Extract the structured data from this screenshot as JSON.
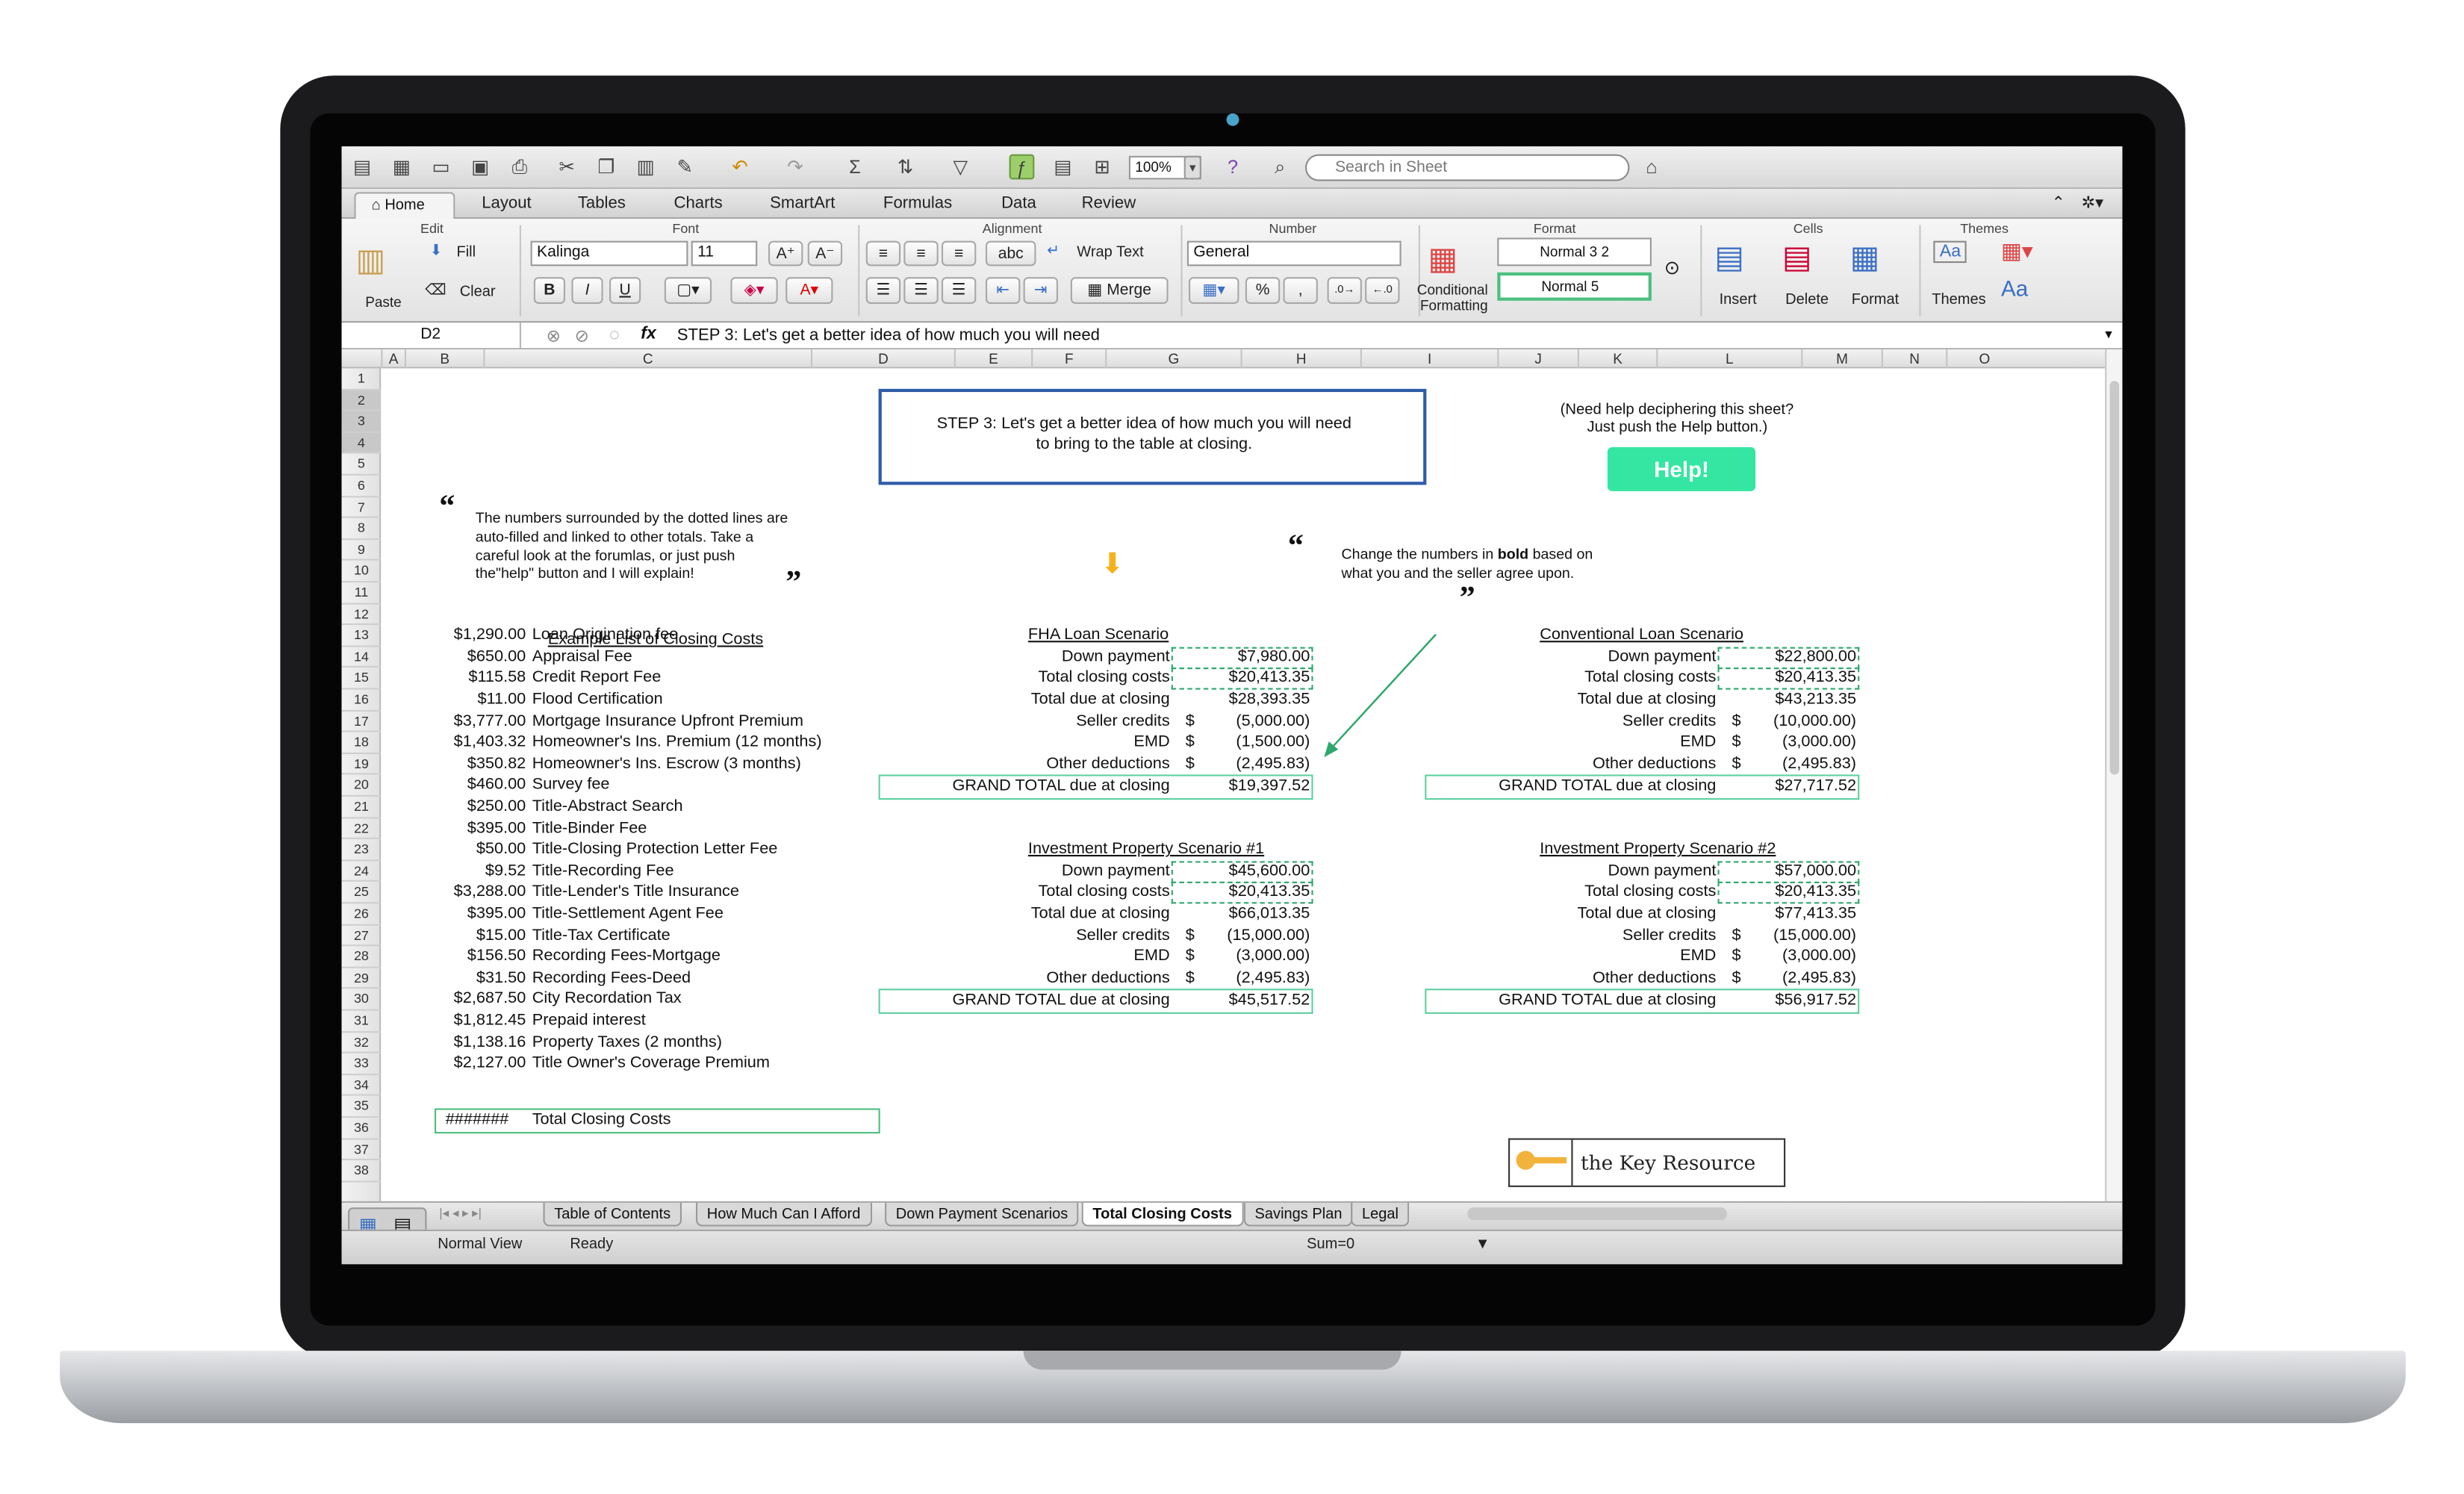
{
  "toolbar": {
    "zoom": "100%",
    "search_placeholder": "Search in Sheet"
  },
  "ribbon_tabs": [
    "Home",
    "Layout",
    "Tables",
    "Charts",
    "SmartArt",
    "Formulas",
    "Data",
    "Review"
  ],
  "ribbon": {
    "groups": {
      "edit": "Edit",
      "font": "Font",
      "alignment": "Alignment",
      "number": "Number",
      "format": "Format",
      "cells": "Cells",
      "themes": "Themes"
    },
    "paste": "Paste",
    "fill": "Fill",
    "clear": "Clear",
    "font_name": "Kalinga",
    "font_size": "11",
    "bold": "B",
    "italic": "I",
    "underline": "U",
    "wrap_text": "Wrap Text",
    "merge": "Merge",
    "abc": "abc",
    "number_format": "General",
    "percent": "%",
    "comma": ",",
    "conditional_formatting": [
      "Conditional",
      "Formatting"
    ],
    "styles": [
      "Normal 3 2",
      "Normal 5"
    ],
    "insert": "Insert",
    "delete": "Delete",
    "format": "Format",
    "themes": "Themes",
    "aa": "Aa"
  },
  "formula_bar": {
    "cell": "D2",
    "fx": "fx",
    "content": "STEP 3: Let's get a better idea of how much you will need"
  },
  "columns": [
    "A",
    "B",
    "C",
    "D",
    "E",
    "F",
    "G",
    "H",
    "I",
    "J",
    "K",
    "L",
    "M",
    "N",
    "O"
  ],
  "rows": [
    "1",
    "2",
    "3",
    "4",
    "5",
    "6",
    "7",
    "8",
    "9",
    "10",
    "11",
    "12",
    "13",
    "14",
    "15",
    "16",
    "17",
    "18",
    "19",
    "20",
    "21",
    "22",
    "23",
    "24",
    "25",
    "26",
    "27",
    "28",
    "29",
    "30",
    "31",
    "32",
    "33",
    "34",
    "35",
    "36",
    "37",
    "38"
  ],
  "sheet": {
    "step3": [
      "STEP 3: Let's get a better idea of how much you will need",
      "to bring to the table at closing."
    ],
    "help_note": [
      "(Need help deciphering this sheet?",
      "Just push the Help button.)"
    ],
    "help_button": "Help!",
    "note_left": [
      "The numbers surrounded by the dotted lines are",
      "auto-filled and linked to other totals. Take a",
      "careful look at the forumlas, or just push",
      "the\"help\" button and I will explain!"
    ],
    "note_right_1": "Change the numbers in ",
    "note_right_bold": "bold",
    "note_right_2": " based on",
    "note_right_3": "what you and the seller agree upon.",
    "quote_open": "“",
    "quote_close": "”",
    "costs_title": "Example List of Closing Costs",
    "costs": [
      {
        "amount": "$1,290.00",
        "label": "Loan Origination fee"
      },
      {
        "amount": "$650.00",
        "label": "Appraisal Fee"
      },
      {
        "amount": "$115.58",
        "label": "Credit Report Fee"
      },
      {
        "amount": "$11.00",
        "label": "Flood Certification"
      },
      {
        "amount": "$3,777.00",
        "label": "Mortgage Insurance Upfront Premium"
      },
      {
        "amount": "$1,403.32",
        "label": "Homeowner's Ins. Premium (12 months)"
      },
      {
        "amount": "$350.82",
        "label": "Homeowner's Ins. Escrow (3 months)"
      },
      {
        "amount": "$460.00",
        "label": "Survey fee"
      },
      {
        "amount": "$250.00",
        "label": "Title-Abstract Search"
      },
      {
        "amount": "$395.00",
        "label": "Title-Binder Fee"
      },
      {
        "amount": "$50.00",
        "label": "Title-Closing Protection Letter Fee"
      },
      {
        "amount": "$9.52",
        "label": "Title-Recording Fee"
      },
      {
        "amount": "$3,288.00",
        "label": "Title-Lender's Title Insurance"
      },
      {
        "amount": "$395.00",
        "label": "Title-Settlement Agent Fee"
      },
      {
        "amount": "$15.00",
        "label": "Title-Tax Certificate"
      },
      {
        "amount": "$156.50",
        "label": "Recording Fees-Mortgage"
      },
      {
        "amount": "$31.50",
        "label": "Recording Fees-Deed"
      },
      {
        "amount": "$2,687.50",
        "label": "City Recordation Tax"
      },
      {
        "amount": "$1,812.45",
        "label": "Prepaid interest"
      },
      {
        "amount": "$1,138.16",
        "label": "Property Taxes (2 months)"
      },
      {
        "amount": "$2,127.00",
        "label": "Title Owner's Coverage Premium"
      }
    ],
    "total_amount": "#######",
    "total_label": "Total Closing Costs",
    "scenarios": [
      {
        "title": "FHA Loan Scenario",
        "down": "$7,980.00",
        "closing": "$20,413.35",
        "due": "$28,393.35",
        "seller": "(5,000.00)",
        "emd": "(1,500.00)",
        "other": "(2,495.83)",
        "grand": "$19,397.52"
      },
      {
        "title": "Conventional Loan Scenario",
        "down": "$22,800.00",
        "closing": "$20,413.35",
        "due": "$43,213.35",
        "seller": "(10,000.00)",
        "emd": "(3,000.00)",
        "other": "(2,495.83)",
        "grand": "$27,717.52"
      },
      {
        "title": "Investment Property Scenario #1",
        "down": "$45,600.00",
        "closing": "$20,413.35",
        "due": "$66,013.35",
        "seller": "(15,000.00)",
        "emd": "(3,000.00)",
        "other": "(2,495.83)",
        "grand": "$45,517.52"
      },
      {
        "title": "Investment Property Scenario #2",
        "down": "$57,000.00",
        "closing": "$20,413.35",
        "due": "$77,413.35",
        "seller": "(15,000.00)",
        "emd": "(3,000.00)",
        "other": "(2,495.83)",
        "grand": "$56,917.52"
      }
    ],
    "labels": {
      "down": "Down payment",
      "closing": "Total closing costs",
      "due": "Total due at closing",
      "seller": "Seller credits",
      "emd": "EMD",
      "other": "Other deductions",
      "grand": "GRAND TOTAL due at closing",
      "dollar": "$"
    },
    "logo_text": "the Key Resource"
  },
  "sheet_tabs": [
    "Table of Contents",
    "How Much Can I Afford",
    "Down Payment Scenarios",
    "Total Closing Costs",
    "Savings Plan",
    "Legal"
  ],
  "status": {
    "view": "Normal View",
    "state": "Ready",
    "sum": "Sum=0"
  },
  "colors": {
    "accent_green": "#34e6a2",
    "dashed_green": "#2ea86b",
    "step_border": "#2e5ca8",
    "arrow_orange": "#f6b21d"
  }
}
